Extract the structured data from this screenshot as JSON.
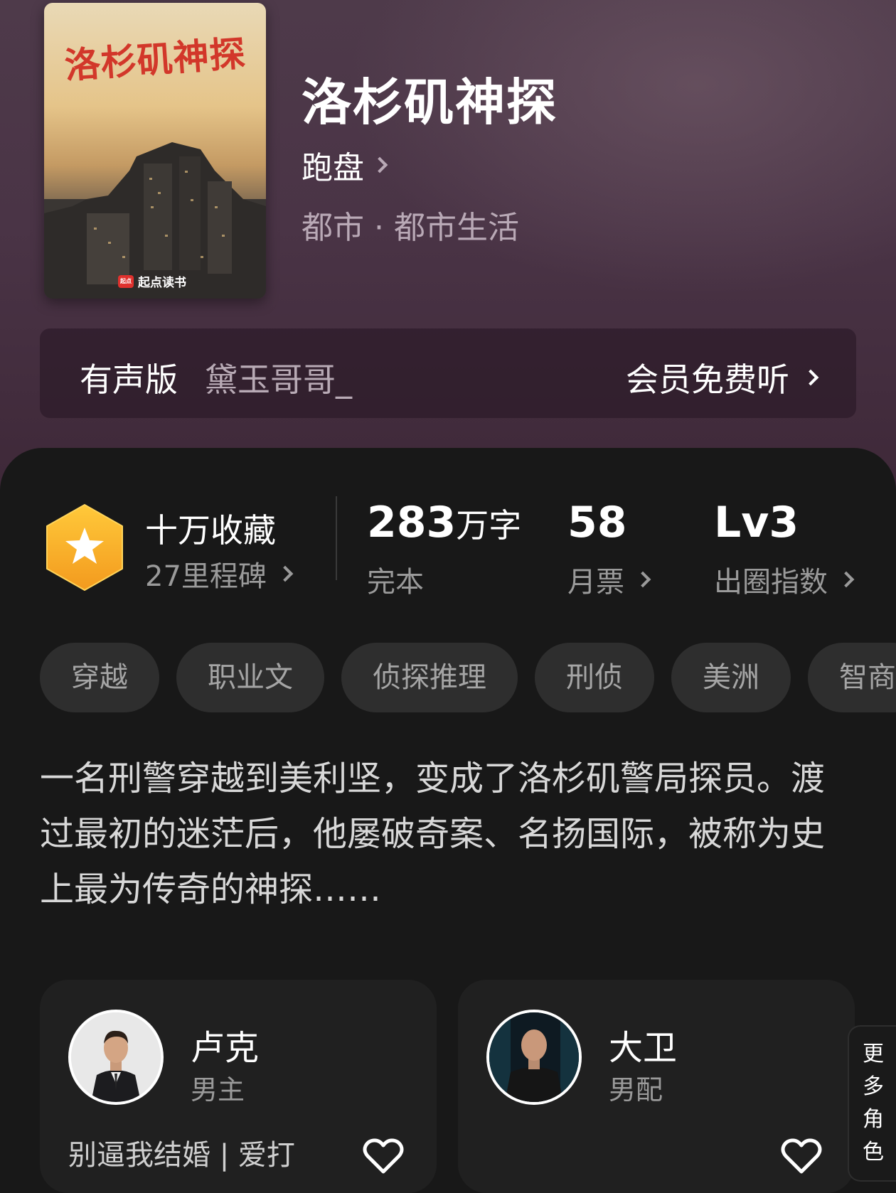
{
  "book": {
    "cover_title": "洛杉矶神探",
    "cover_brand": "起点读书",
    "cover_brand_badge": "起点",
    "title": "洛杉矶神探",
    "author": "跑盘",
    "genre": "都市 · 都市生活"
  },
  "audio": {
    "label": "有声版",
    "narrator": "黛玉哥哥_",
    "action": "会员免费听"
  },
  "stats": {
    "collect_title": "十万收藏",
    "milestone": "27里程碑",
    "words_num": "283",
    "words_unit": "万字",
    "status": "完本",
    "monthly_tickets": "58",
    "monthly_label": "月票",
    "level": "Lv3",
    "level_label": "出圈指数"
  },
  "tags": [
    "穿越",
    "职业文",
    "侦探推理",
    "刑侦",
    "美洲",
    "智商"
  ],
  "description": "一名刑警穿越到美利坚，变成了洛杉矶警局探员。渡过最初的迷茫后，他屡破奇案、名扬国际，被称为史上最为传奇的神探……",
  "characters": [
    {
      "name": "卢克",
      "role": "男主",
      "desc": "别逼我结婚 | 爱打"
    },
    {
      "name": "大卫",
      "role": "男配",
      "desc": ""
    }
  ],
  "more_roles": [
    "更",
    "多",
    "角",
    "色"
  ],
  "colors": {
    "accent_gold": "#f7b733",
    "hero_bg": "#4a3446",
    "panel_bg": "#181818"
  }
}
